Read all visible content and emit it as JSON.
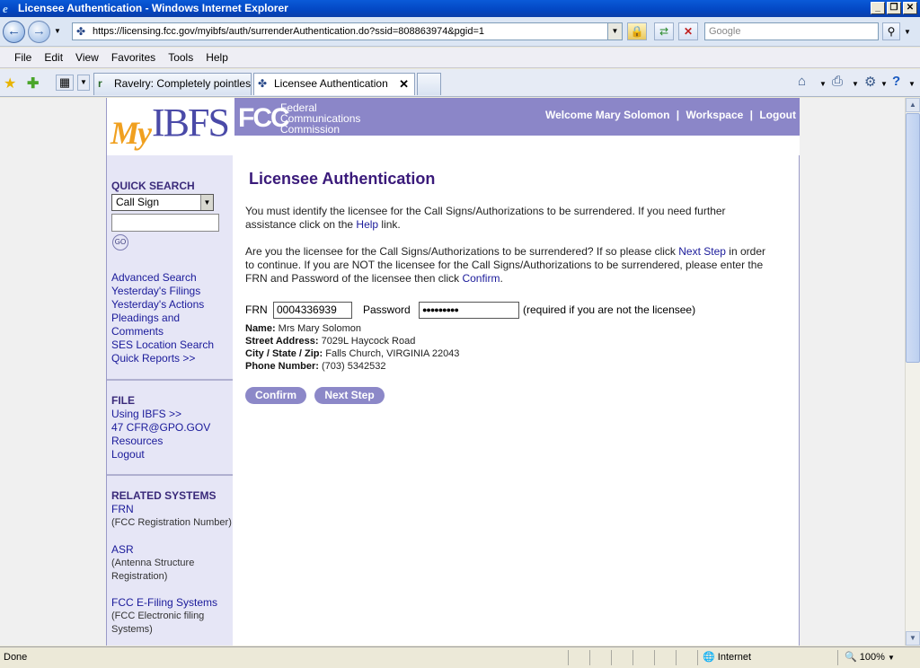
{
  "window": {
    "title": "Licensee Authentication - Windows Internet Explorer",
    "min": "_",
    "max": "❐",
    "close": "✕"
  },
  "addressbar": {
    "url": "https://licensing.fcc.gov/myibfs/auth/surrenderAuthentication.do?ssid=808863974&pgid=1",
    "search_placeholder": "Google"
  },
  "menu": [
    "File",
    "Edit",
    "View",
    "Favorites",
    "Tools",
    "Help"
  ],
  "tabs": [
    {
      "label": "Ravelry: Completely pointles..."
    },
    {
      "label": "Licensee Authentication"
    }
  ],
  "banner": {
    "logo_my": "My",
    "logo_ibfs": "IBFS",
    "fcc": "FCC",
    "fcc_line1": "Federal",
    "fcc_line2": "Communications",
    "fcc_line3": "Commission",
    "welcome": "Welcome Mary Solomon",
    "workspace": "Workspace",
    "logout": "Logout",
    "sep": "|"
  },
  "sidebar": {
    "quick_search_title": "QUICK SEARCH",
    "quick_search_selected": "Call Sign",
    "go_label": "GO",
    "links": [
      "Advanced Search",
      "Yesterday's Filings",
      "Yesterday's Actions",
      "Pleadings and",
      "Comments",
      "SES Location Search",
      "Quick Reports >>"
    ],
    "file_title": "FILE",
    "file_links": [
      "Using IBFS >>",
      "47 CFR@GPO.GOV",
      "Resources",
      "Logout"
    ],
    "related_title": "RELATED SYSTEMS",
    "frn": "FRN",
    "frn_note": "(FCC Registration Number)",
    "asr": "ASR",
    "asr_note1": "(Antenna Structure",
    "asr_note2": "Registration)",
    "efiling": "FCC E-Filing Systems",
    "efiling_note1": "(FCC Electronic filing",
    "efiling_note2": "Systems)"
  },
  "main": {
    "heading": "Licensee Authentication",
    "p1_a": "You must identify the licensee for the Call Signs/Authorizations to be surrendered. If you need further",
    "p1_b": "assistance click on the ",
    "p1_link": "Help",
    "p1_c": " link.",
    "p2_a": "Are you the licensee for the Call Signs/Authorizations to be surrendered? If so please click ",
    "p2_link1": "Next Step",
    "p2_b": " in order",
    "p2_c": "to continue. If you are NOT the licensee for the Call Signs/Authorizations to be surrendered, please enter the",
    "p2_d": "FRN and Password of the licensee then click ",
    "p2_link2": "Confirm",
    "p2_e": ".",
    "frn_label": "FRN",
    "frn_value": "0004336939",
    "password_label": "Password",
    "password_value": "●●●●●●●●●",
    "required_note": "(required if you are not the licensee)",
    "name_label": "Name:",
    "name_value": " Mrs Mary Solomon",
    "street_label": "Street Address:",
    "street_value": " 7029L Haycock Road",
    "city_label": "City / State / Zip:",
    "city_value": " Falls Church, VIRGINIA 22043",
    "phone_label": "Phone Number:",
    "phone_value": " (703) 5342532",
    "confirm_btn": "Confirm",
    "next_btn": "Next Step"
  },
  "statusbar": {
    "status": "Done",
    "zone": "Internet",
    "zoom": "100%"
  }
}
